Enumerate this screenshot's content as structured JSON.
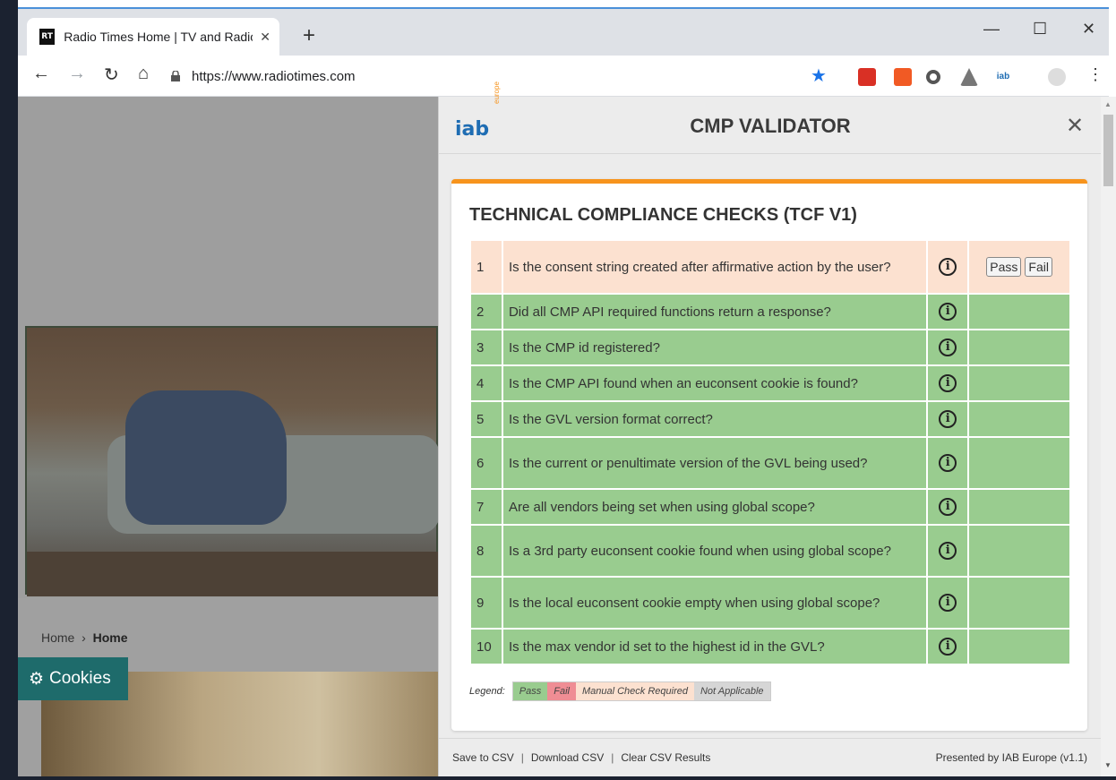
{
  "browser": {
    "tab_title": "Radio Times Home | TV and Radio",
    "tab_favicon": "RT",
    "url": "https://www.radiotimes.com"
  },
  "page": {
    "breadcrumb_root": "Home",
    "breadcrumb_current": "Home",
    "cookies_label": "Cookies"
  },
  "panel": {
    "logo_text": "iab",
    "logo_sub": "europe",
    "title": "CMP VALIDATOR",
    "section_title": "TECHNICAL COMPLIANCE CHECKS (TCF V1)",
    "pass_label": "Pass",
    "fail_label": "Fail",
    "info_glyph": "i",
    "checks": [
      {
        "num": "1",
        "question": "Is the consent string created after affirmative action by the user?",
        "status": "manual"
      },
      {
        "num": "2",
        "question": "Did all CMP API required functions return a response?",
        "status": "pass"
      },
      {
        "num": "3",
        "question": "Is the CMP id registered?",
        "status": "pass"
      },
      {
        "num": "4",
        "question": "Is the CMP API found when an euconsent cookie is found?",
        "status": "pass"
      },
      {
        "num": "5",
        "question": "Is the GVL version format correct?",
        "status": "pass"
      },
      {
        "num": "6",
        "question": "Is the current or penultimate version of the GVL being used?",
        "status": "pass"
      },
      {
        "num": "7",
        "question": "Are all vendors being set when using global scope?",
        "status": "pass"
      },
      {
        "num": "8",
        "question": "Is a 3rd party euconsent cookie found when using global scope?",
        "status": "pass"
      },
      {
        "num": "9",
        "question": "Is the local euconsent cookie empty when using global scope?",
        "status": "pass"
      },
      {
        "num": "10",
        "question": "Is the max vendor id set to the highest id in the GVL?",
        "status": "pass"
      }
    ],
    "legend": {
      "label": "Legend:",
      "pass": "Pass",
      "fail": "Fail",
      "manual": "Manual Check Required",
      "na": "Not Applicable"
    },
    "footer": {
      "save": "Save to CSV",
      "download": "Download CSV",
      "clear": "Clear CSV Results",
      "separator": "|",
      "credit": "Presented by IAB Europe (v1.1)"
    }
  },
  "colors": {
    "pass": "#99cc8f",
    "fail": "#ef8d94",
    "manual": "#fce1d0",
    "na": "#d6d6d6",
    "accent": "#f7941d",
    "cookies_bg": "#1e6b6b"
  },
  "icons": {
    "back": "back-arrow-icon",
    "forward": "forward-arrow-icon",
    "reload": "reload-icon",
    "home": "home-icon",
    "lock": "lock-icon",
    "star": "star-icon",
    "info": "info-icon",
    "close": "close-icon",
    "gear": "gear-icon"
  }
}
